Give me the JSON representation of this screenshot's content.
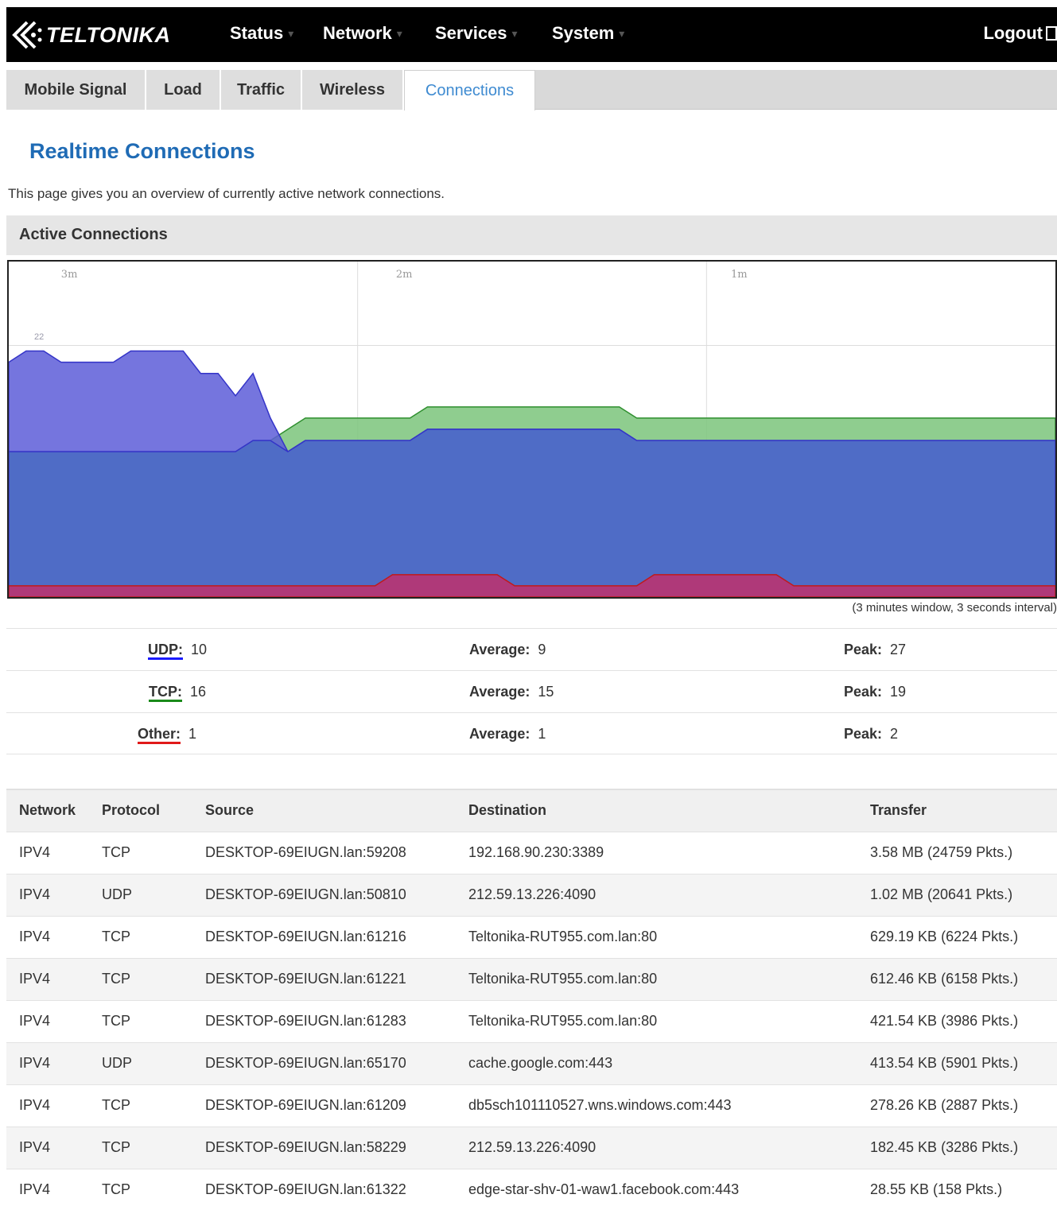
{
  "brand": {
    "name": "TELTONIKA"
  },
  "nav": {
    "items": [
      {
        "label": "Status"
      },
      {
        "label": "Network"
      },
      {
        "label": "Services"
      },
      {
        "label": "System"
      }
    ],
    "logout": "Logout"
  },
  "tabs": [
    {
      "label": "Mobile Signal"
    },
    {
      "label": "Load"
    },
    {
      "label": "Traffic"
    },
    {
      "label": "Wireless"
    },
    {
      "label": "Connections",
      "active": true
    }
  ],
  "page": {
    "title": "Realtime Connections",
    "description": "This page gives you an overview of currently active network connections."
  },
  "section": {
    "title": "Active Connections"
  },
  "graph": {
    "time_labels": [
      "3m",
      "2m",
      "1m"
    ],
    "y_label": "22",
    "note": "(3 minutes window, 3 seconds interval)",
    "colors": {
      "udp": "#5d5dd8",
      "tcp": "#7bc47b",
      "other": "#c0306b"
    }
  },
  "chart_data": {
    "type": "area",
    "title": "",
    "x": [
      0,
      3,
      6,
      9,
      12,
      15,
      18,
      21,
      24,
      27,
      30,
      33,
      36,
      39,
      42,
      45,
      48,
      51,
      54,
      57,
      60,
      63,
      66,
      69,
      72,
      75,
      78,
      81,
      84,
      87,
      90,
      93,
      96,
      99,
      102,
      105,
      108,
      111,
      114,
      117,
      120,
      123,
      126,
      129,
      132,
      135,
      138,
      141,
      144,
      147,
      150,
      153,
      156,
      159,
      162,
      165,
      168,
      171,
      174,
      177,
      180
    ],
    "series": [
      {
        "name": "UDP",
        "values": [
          8,
          9,
          9,
          8,
          8,
          8,
          8,
          9,
          9,
          9,
          9,
          7,
          7,
          5,
          6,
          2,
          0,
          0,
          0,
          0,
          0,
          0,
          0,
          0,
          0,
          0,
          0,
          0,
          0,
          0,
          0,
          0,
          0,
          0,
          0,
          0,
          0,
          0,
          0,
          0,
          0,
          0,
          0,
          0,
          0,
          0,
          0,
          0,
          0,
          0,
          0,
          0,
          0,
          0,
          0,
          0,
          0,
          0,
          0,
          0,
          0
        ]
      },
      {
        "name": "TCP",
        "values": [
          13,
          13,
          13,
          13,
          13,
          13,
          13,
          13,
          13,
          13,
          13,
          13,
          13,
          13,
          14,
          14,
          15,
          16,
          16,
          16,
          16,
          16,
          16,
          16,
          17,
          17,
          17,
          17,
          17,
          17,
          17,
          17,
          17,
          17,
          17,
          17,
          16,
          16,
          16,
          16,
          16,
          16,
          16,
          16,
          16,
          16,
          16,
          16,
          16,
          16,
          16,
          16,
          16,
          16,
          16,
          16,
          16,
          16,
          16,
          16,
          16
        ]
      },
      {
        "name": "Other",
        "values": [
          1,
          1,
          1,
          1,
          1,
          1,
          1,
          1,
          1,
          1,
          1,
          1,
          1,
          1,
          1,
          1,
          1,
          1,
          1,
          1,
          1,
          1,
          2,
          2,
          2,
          2,
          2,
          2,
          2,
          1,
          1,
          1,
          1,
          1,
          1,
          1,
          1,
          2,
          2,
          2,
          2,
          2,
          2,
          2,
          2,
          1,
          1,
          1,
          1,
          1,
          1,
          1,
          1,
          1,
          1,
          1,
          1,
          1,
          1,
          1,
          1
        ]
      }
    ],
    "xlabel": "",
    "ylabel": "",
    "ylim": [
      0,
      30
    ],
    "grid": true
  },
  "stats": [
    {
      "name": "UDP:",
      "current": "10",
      "avg_label": "Average:",
      "avg": "9",
      "peak_label": "Peak:",
      "peak": "27"
    },
    {
      "name": "TCP:",
      "current": "16",
      "avg_label": "Average:",
      "avg": "15",
      "peak_label": "Peak:",
      "peak": "19"
    },
    {
      "name": "Other:",
      "current": "1",
      "avg_label": "Average:",
      "avg": "1",
      "peak_label": "Peak:",
      "peak": "2"
    }
  ],
  "table": {
    "headers": [
      "Network",
      "Protocol",
      "Source",
      "Destination",
      "Transfer"
    ],
    "rows": [
      [
        "IPV4",
        "TCP",
        "DESKTOP-69EIUGN.lan:59208",
        "192.168.90.230:3389",
        "3.58 MB (24759 Pkts.)"
      ],
      [
        "IPV4",
        "UDP",
        "DESKTOP-69EIUGN.lan:50810",
        "212.59.13.226:4090",
        "1.02 MB (20641 Pkts.)"
      ],
      [
        "IPV4",
        "TCP",
        "DESKTOP-69EIUGN.lan:61216",
        "Teltonika-RUT955.com.lan:80",
        "629.19 KB (6224 Pkts.)"
      ],
      [
        "IPV4",
        "TCP",
        "DESKTOP-69EIUGN.lan:61221",
        "Teltonika-RUT955.com.lan:80",
        "612.46 KB (6158 Pkts.)"
      ],
      [
        "IPV4",
        "TCP",
        "DESKTOP-69EIUGN.lan:61283",
        "Teltonika-RUT955.com.lan:80",
        "421.54 KB (3986 Pkts.)"
      ],
      [
        "IPV4",
        "UDP",
        "DESKTOP-69EIUGN.lan:65170",
        "cache.google.com:443",
        "413.54 KB (5901 Pkts.)"
      ],
      [
        "IPV4",
        "TCP",
        "DESKTOP-69EIUGN.lan:61209",
        "db5sch101110527.wns.windows.com:443",
        "278.26 KB (2887 Pkts.)"
      ],
      [
        "IPV4",
        "TCP",
        "DESKTOP-69EIUGN.lan:58229",
        "212.59.13.226:4090",
        "182.45 KB (3286 Pkts.)"
      ],
      [
        "IPV4",
        "TCP",
        "DESKTOP-69EIUGN.lan:61322",
        "edge-star-shv-01-waw1.facebook.com:443",
        "28.55 KB (158 Pkts.)"
      ]
    ]
  }
}
